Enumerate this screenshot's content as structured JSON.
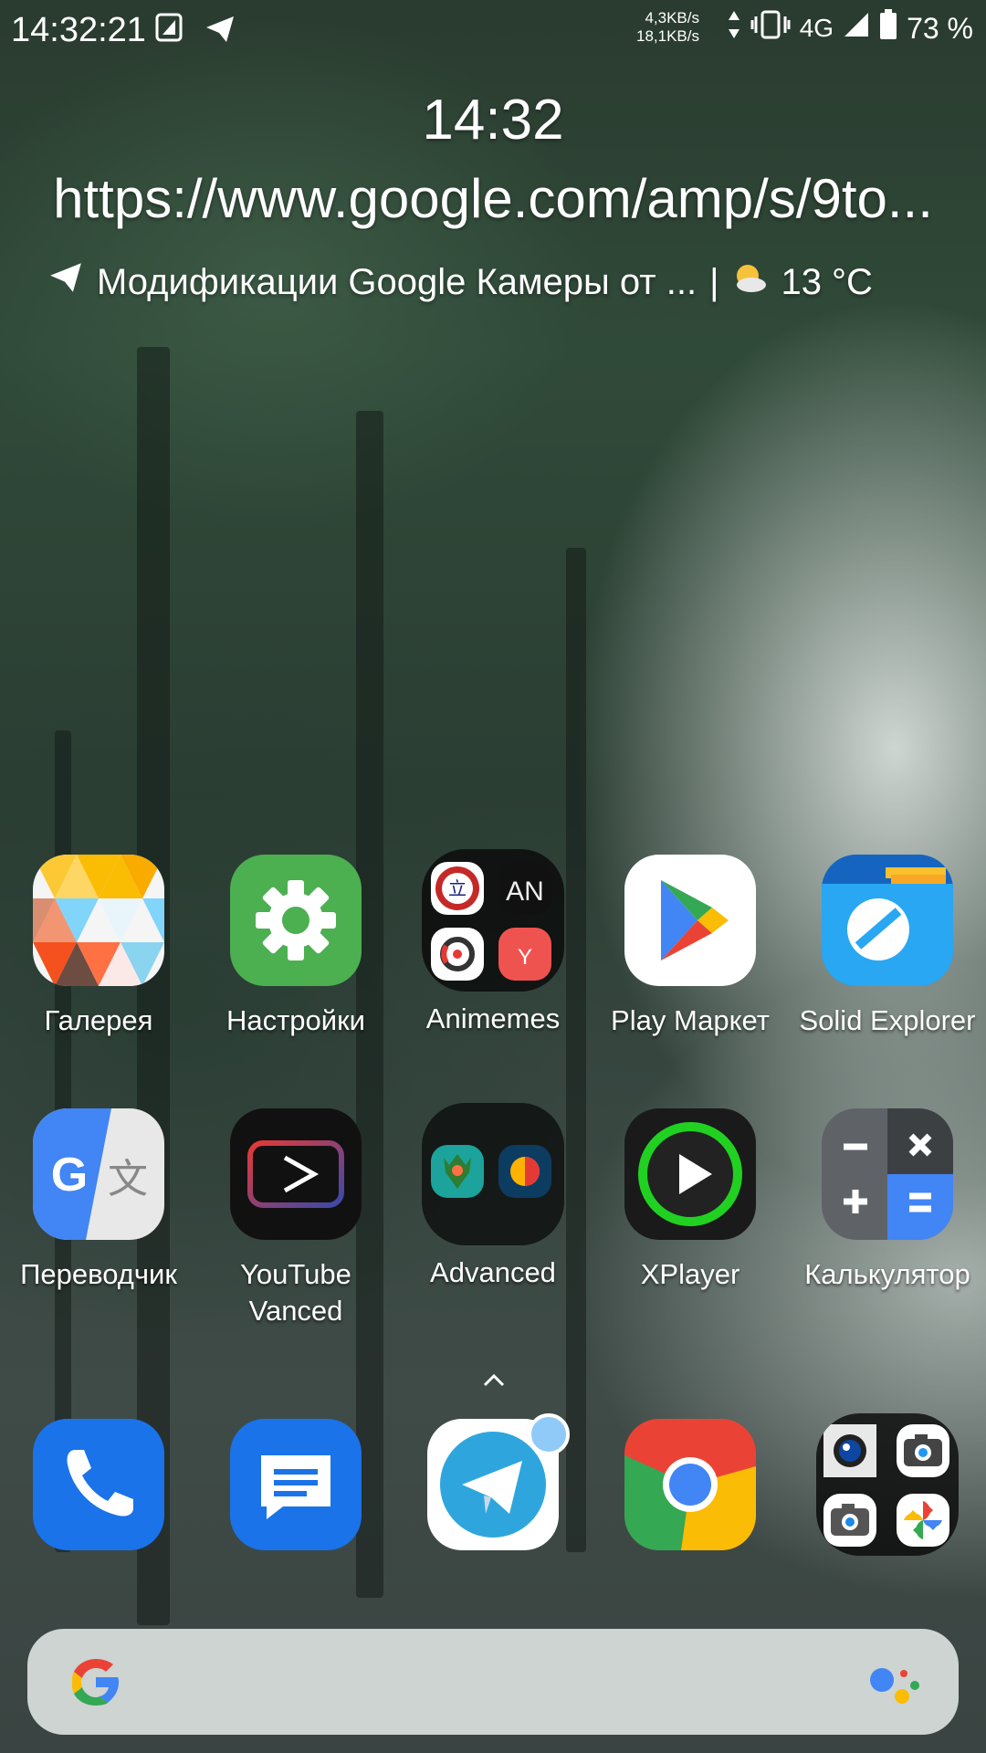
{
  "status_bar": {
    "time": "14:32:21",
    "net_up": "4,3KB/s",
    "net_down": "18,1KB/s",
    "network": "4G",
    "battery": "73 %",
    "icons": [
      "screenshot-icon",
      "telegram-icon",
      "data-arrows-icon",
      "vibrate-icon",
      "signal-icon",
      "battery-icon"
    ]
  },
  "widget": {
    "clock": "14:32",
    "url": "https://www.google.com/amp/s/9to...",
    "news": "Модификации Google Камеры от ...",
    "separator": "|",
    "temperature": "13 °C",
    "weather_icon": "sun-cloud-icon"
  },
  "apps": [
    {
      "label": "Галерея",
      "icon": "gallery-icon"
    },
    {
      "label": "Настройки",
      "icon": "settings-icon"
    },
    {
      "label": "Animemes",
      "icon": "folder-icon"
    },
    {
      "label": "Play Маркет",
      "icon": "play-store-icon"
    },
    {
      "label": "Solid Explorer",
      "icon": "solid-explorer-icon"
    },
    {
      "label": "Переводчик",
      "icon": "translate-icon"
    },
    {
      "label": "YouTube Vanced",
      "icon": "youtube-vanced-icon"
    },
    {
      "label": "Advanced",
      "icon": "folder-icon"
    },
    {
      "label": "XPlayer",
      "icon": "xplayer-icon"
    },
    {
      "label": "Калькулятор",
      "icon": "calculator-icon"
    }
  ],
  "folder_animemes": {
    "mini_labels": [
      "立",
      "AN",
      "",
      "Y"
    ]
  },
  "dock": [
    "phone-icon",
    "messages-icon",
    "telegram-icon",
    "chrome-icon",
    "camera-folder-icon"
  ],
  "colors": {
    "accent_green": "#4caf50",
    "google_blue": "#4285f4",
    "google_red": "#ea4335",
    "google_yellow": "#fbbc05",
    "google_green": "#34a853",
    "telegram": "#2ea6dd"
  }
}
